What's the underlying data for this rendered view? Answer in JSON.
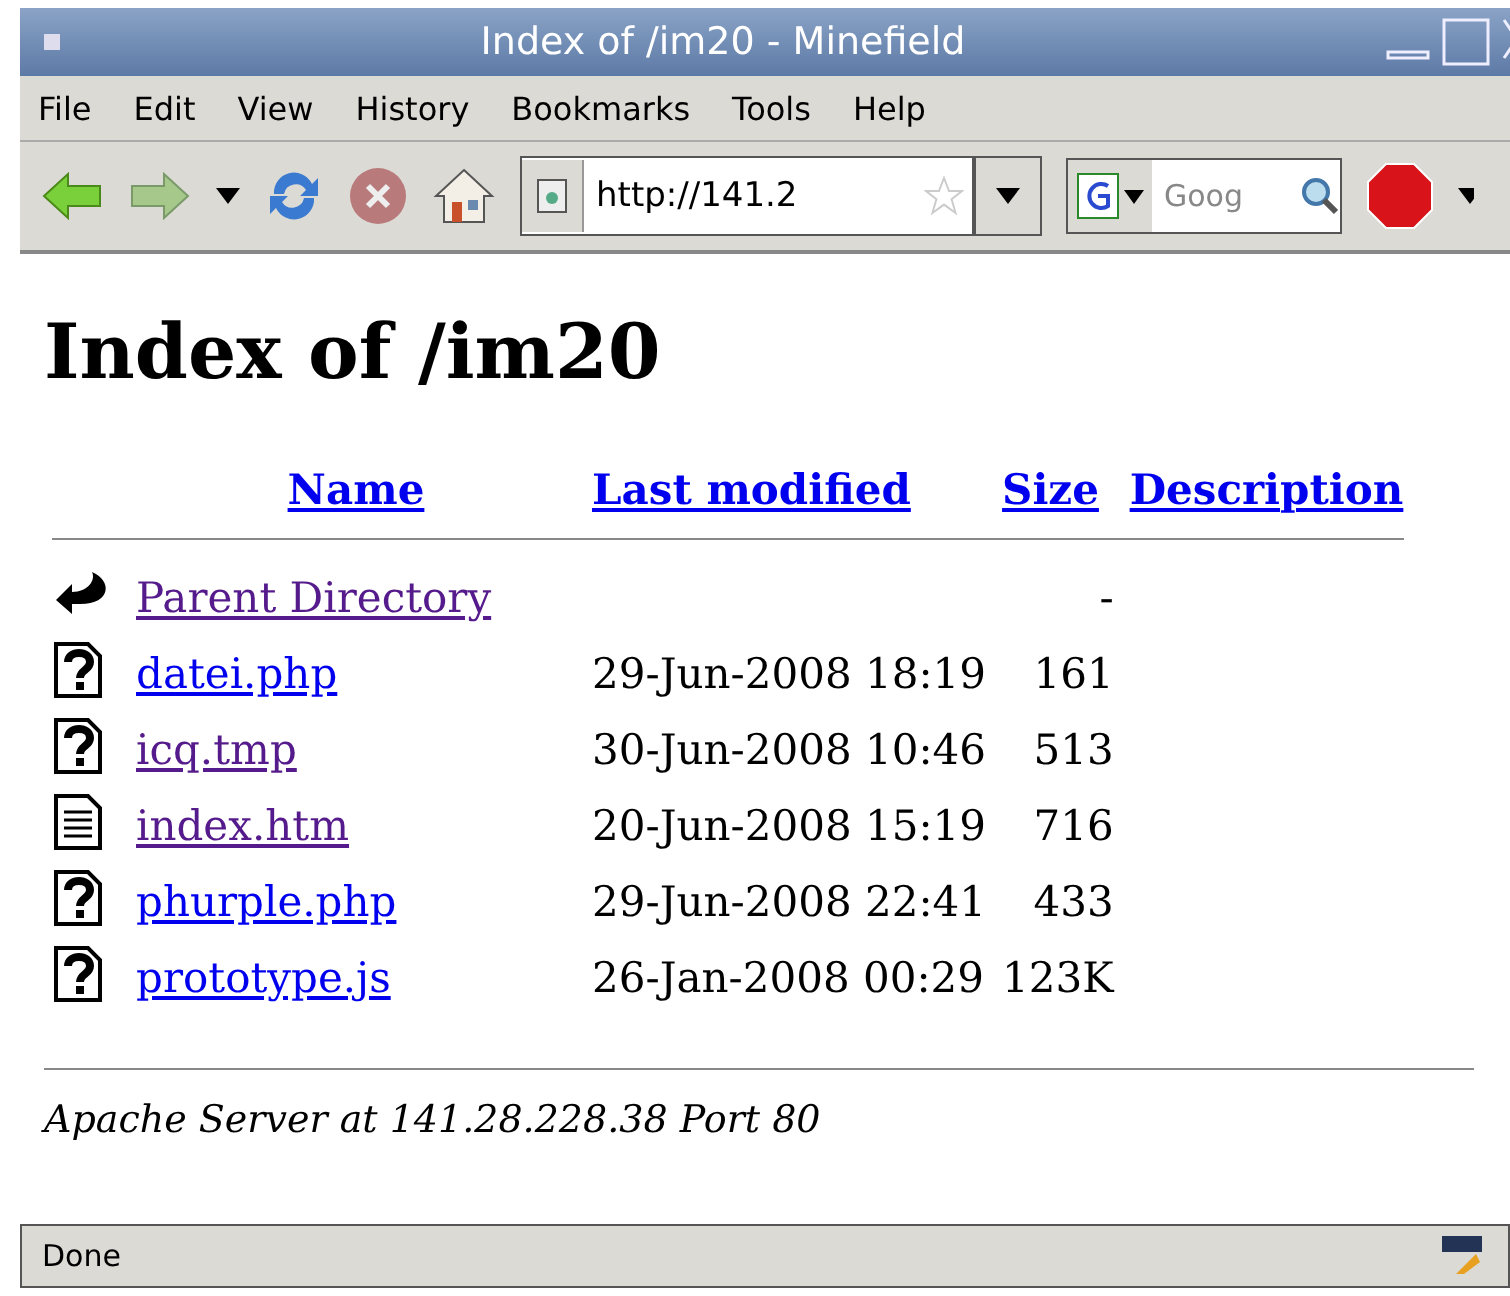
{
  "window": {
    "title": "Index of /im20 - Minefield"
  },
  "menu": [
    {
      "label": "File"
    },
    {
      "label": "Edit"
    },
    {
      "label": "View"
    },
    {
      "label": "History"
    },
    {
      "label": "Bookmarks"
    },
    {
      "label": "Tools"
    },
    {
      "label": "Help"
    }
  ],
  "toolbar": {
    "url": "http://141.2",
    "search_placeholder": "Goog"
  },
  "page": {
    "heading": "Index of /im20",
    "columns": [
      "Name",
      "Last modified",
      "Size",
      "Description"
    ],
    "rows": [
      {
        "kind": "parent",
        "name": "Parent Directory",
        "modified": "",
        "size": "-",
        "visited": true
      },
      {
        "kind": "unknown",
        "name": "datei.php",
        "modified": "29-Jun-2008 18:19",
        "size": "161",
        "visited": false
      },
      {
        "kind": "unknown",
        "name": "icq.tmp",
        "modified": "30-Jun-2008 10:46",
        "size": "513",
        "visited": true
      },
      {
        "kind": "text",
        "name": "index.htm",
        "modified": "20-Jun-2008 15:19",
        "size": "716",
        "visited": true
      },
      {
        "kind": "unknown",
        "name": "phurple.php",
        "modified": "29-Jun-2008 22:41",
        "size": "433",
        "visited": false
      },
      {
        "kind": "unknown",
        "name": "prototype.js",
        "modified": "26-Jan-2008 00:29",
        "size": "123K",
        "visited": false
      }
    ],
    "address": "Apache Server at 141.28.228.38 Port 80"
  },
  "status_bar": {
    "text": "Done"
  }
}
